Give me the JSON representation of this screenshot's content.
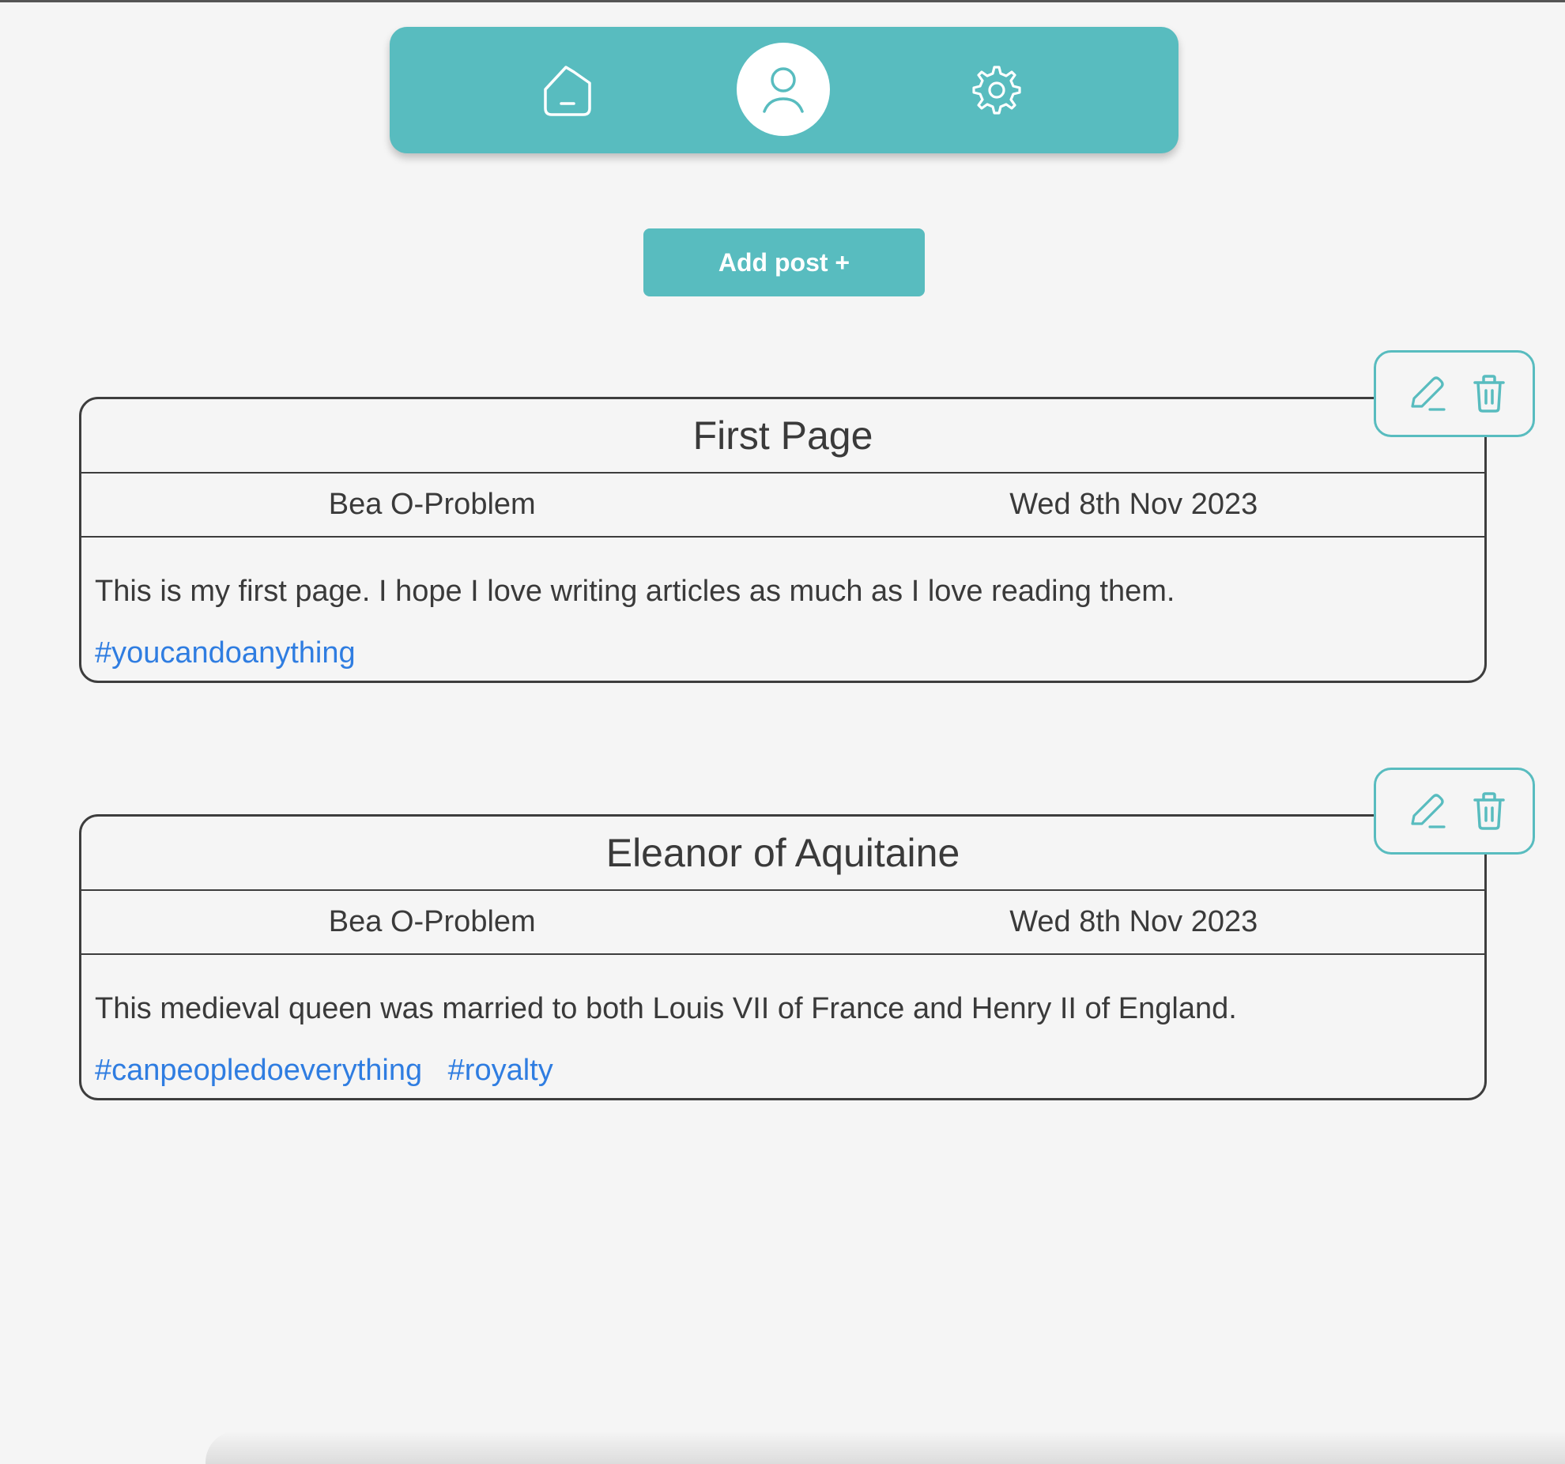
{
  "nav": {
    "items": [
      {
        "icon": "home-icon",
        "active": false
      },
      {
        "icon": "user-icon",
        "active": true
      },
      {
        "icon": "gear-icon",
        "active": false
      }
    ]
  },
  "add_post_label": "Add post +",
  "posts": [
    {
      "title": "First Page",
      "author": "Bea O-Problem",
      "date": "Wed 8th Nov 2023",
      "body": "This is my first page. I hope I love writing articles as much as I love reading them.",
      "tags": [
        "#youcandoanything"
      ]
    },
    {
      "title": "Eleanor of Aquitaine",
      "author": "Bea O-Problem",
      "date": "Wed 8th Nov 2023",
      "body": "This medieval queen was married to both Louis VII of France and Henry II of England.",
      "tags": [
        "#canpeopledoeverything",
        "#royalty"
      ]
    }
  ],
  "colors": {
    "accent": "#58bcbf",
    "background": "#f5f5f5",
    "text": "#3a3a3a",
    "tag": "#2f7de1",
    "border": "#3d3d3d"
  }
}
